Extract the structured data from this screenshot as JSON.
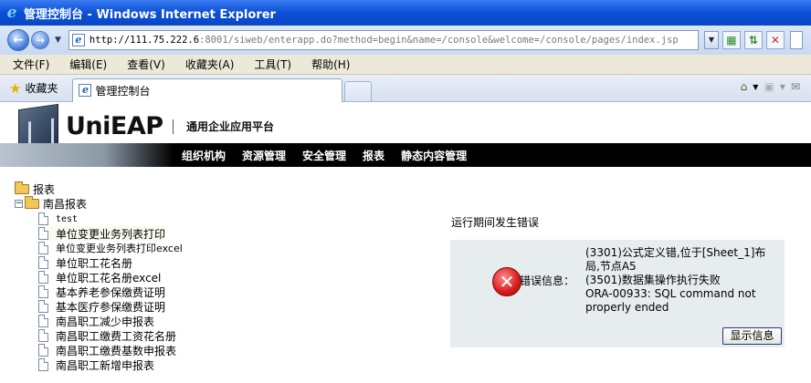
{
  "window": {
    "title": "管理控制台 - Windows Internet Explorer"
  },
  "address": {
    "host": "http://111.75.222.6",
    "rest": ":8001/siweb/enterapp.do?method=begin&name=/console&welcome=/console/pages/index.jsp"
  },
  "menu": [
    "文件(F)",
    "编辑(E)",
    "查看(V)",
    "收藏夹(A)",
    "工具(T)",
    "帮助(H)"
  ],
  "favorites": {
    "label": "收藏夹",
    "tab_title": "管理控制台"
  },
  "header": {
    "logo": "UniEAP",
    "subtitle": "通用企业应用平台",
    "nav": [
      "组织机构",
      "资源管理",
      "安全管理",
      "报表",
      "静态内容管理"
    ]
  },
  "tree": {
    "root": "报表",
    "folder": "南昌报表",
    "items": [
      "test",
      "单位变更业务列表打印",
      "单位变更业务列表打印excel",
      "单位职工花名册",
      "单位职工花名册excel",
      "基本养老参保缴费证明",
      "基本医疗参保缴费证明",
      "南昌职工减少申报表",
      "南昌职工缴费工资花名册",
      "南昌职工缴费基数申报表",
      "南昌职工新增申报表"
    ]
  },
  "error": {
    "title": "运行期间发生错误",
    "label": "错误信息：",
    "lines": [
      "(3301)公式定义错,位于[Sheet_1]布局,节点A5",
      "(3501)数据集操作执行失败",
      "ORA-00933: SQL command not properly ended"
    ],
    "button": "显示信息"
  }
}
